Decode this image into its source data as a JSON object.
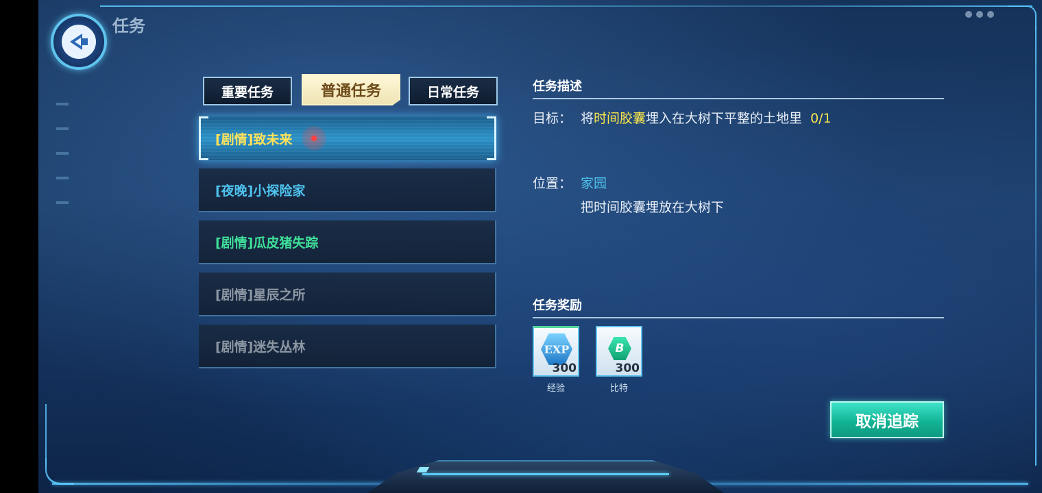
{
  "header": {
    "title": "任务",
    "back_icon": "back-arrow-icon"
  },
  "tabs": [
    {
      "label": "重要任务",
      "active": false
    },
    {
      "label": "普通任务",
      "active": true
    },
    {
      "label": "日常任务",
      "active": false
    }
  ],
  "tasks": [
    {
      "label": "[剧情]致未来",
      "color": "#ffe25a",
      "active": true,
      "tracked": true
    },
    {
      "label": "[夜晚]小探险家",
      "color": "#4fc3ef",
      "active": false
    },
    {
      "label": "[剧情]瓜皮猪失踪",
      "color": "#3fe09a",
      "active": false
    },
    {
      "label": "[剧情]星辰之所",
      "color": "#8d97a3",
      "active": false
    },
    {
      "label": "[剧情]迷失丛林",
      "color": "#8d97a3",
      "active": false
    }
  ],
  "description": {
    "section_title": "任务描述",
    "target_label": "目标：",
    "target_pre": "将",
    "target_highlight": "时间胶囊",
    "target_post": "埋入在大树下平整的土地里",
    "target_progress": "0/1",
    "location_label": "位置：",
    "location_value": "家园",
    "location_hint": "把时间胶囊埋放在大树下"
  },
  "rewards": {
    "section_title": "任务奖励",
    "items": [
      {
        "icon": "exp-icon",
        "icon_text": "EXP",
        "quantity": "300",
        "label": "经验"
      },
      {
        "icon": "bit-coin-icon",
        "icon_text": "B",
        "quantity": "300",
        "label": "比特"
      }
    ]
  },
  "actions": {
    "cancel_tracking": "取消追踪"
  },
  "colors": {
    "accent": "#5fc4ee",
    "highlight": "#ffe94a",
    "button": "#13b496"
  }
}
